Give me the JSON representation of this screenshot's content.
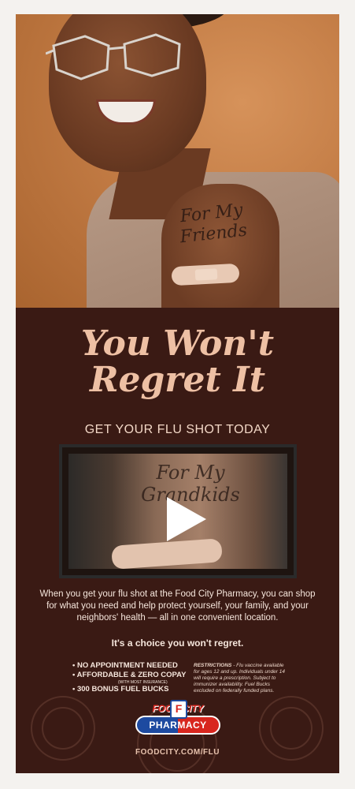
{
  "photo": {
    "tattoo_text": [
      "For My",
      "Friends"
    ]
  },
  "headline": {
    "line1": "You Won't",
    "line2": "Regret It"
  },
  "subhead": "GET YOUR FLU SHOT TODAY",
  "video": {
    "tattoo_text": [
      "For My",
      "Grandkids"
    ]
  },
  "body": {
    "text": "When you get your flu shot at the Food City Pharmacy, you can shop for what you need and help protect yourself, your family, and your neighbors' health — all in one convenient location.",
    "bold": "It's a choice you won't regret."
  },
  "bullets": {
    "item1": "• NO APPOINTMENT NEEDED",
    "item2": "• AFFORDABLE & ZERO COPAY",
    "item2_note": "(WITH MOST INSURANCE)",
    "item3": "• 300 BONUS FUEL BUCKS"
  },
  "restrictions": {
    "label": "RESTRICTIONS",
    "text": " - Flu vaccine available for ages 12 and up. Individuals under 14 will require a prescription. Subject to immunizer availability. Fuel Bucks excluded on federally funded plans."
  },
  "logo": {
    "top": "FOOD CITY",
    "f": "F",
    "bottom": "PHARMACY"
  },
  "url": "FOODCITY.COM/FLU",
  "colors": {
    "background": "#3a1a14",
    "headline": "#eec0a4",
    "brand_blue": "#1d4aa0",
    "brand_red": "#d8261e"
  },
  "icons": [
    "play-icon"
  ]
}
